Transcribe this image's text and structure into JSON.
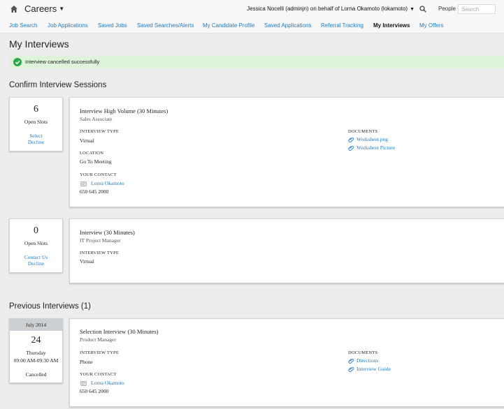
{
  "header": {
    "app_title": "Careers",
    "user_text": "Jessica Nocelli (adminjn) on behalf of Lorna Okamoto (lokamoto)",
    "people_label": "People",
    "search_placeholder": "Search"
  },
  "nav": {
    "tabs": [
      {
        "label": "Job Search",
        "active": false
      },
      {
        "label": "Job Applications",
        "active": false
      },
      {
        "label": "Saved Jobs",
        "active": false
      },
      {
        "label": "Saved Searches/Alerts",
        "active": false
      },
      {
        "label": "My Candidate Profile",
        "active": false
      },
      {
        "label": "Saved Applications",
        "active": false
      },
      {
        "label": "Referral Tracking",
        "active": false
      },
      {
        "label": "My Interviews",
        "active": true
      },
      {
        "label": "My Offers",
        "active": false
      }
    ]
  },
  "page": {
    "title": "My Interviews",
    "alert": "Interview cancelled successfully"
  },
  "confirm_section": {
    "title": "Confirm Interview Sessions",
    "sessions": [
      {
        "slots": "6",
        "slots_label": "Open Slots",
        "action1": "Select",
        "action2": "Decline",
        "title": "Interview High Volume (30 Minutes)",
        "subtitle": "Sales Associate",
        "type_label": "INTERVIEW TYPE",
        "type_value": "Virtual",
        "location_label": "LOCATION",
        "location_value": "Go To Meeting",
        "contact_label": "YOUR CONTACT",
        "contact_name": "Lorna Okamoto",
        "contact_phone": "650 645 2000",
        "documents_label": "DOCUMENTS",
        "documents": [
          "Worksheet.png",
          "Worksheet Picture"
        ]
      },
      {
        "slots": "0",
        "slots_label": "Open Slots",
        "action1": "Contact Us",
        "action2": "Decline",
        "title": "Interview (30 Minutes)",
        "subtitle": "IT Project Manager",
        "type_label": "INTERVIEW TYPE",
        "type_value": "Virtual"
      }
    ]
  },
  "previous_section": {
    "title": "Previous Interviews (1)",
    "interviews": [
      {
        "month": "July 2014",
        "day": "24",
        "weekday": "Thursday",
        "time": "09:00 AM-09:30 AM",
        "status": "Cancelled",
        "title": "Selection Interview (30 Minutes)",
        "subtitle": "Product Manager",
        "type_label": "INTERVIEW TYPE",
        "type_value": "Phone",
        "contact_label": "YOUR CONTACT",
        "contact_name": "Lorna Okamoto",
        "contact_phone": "650 645 2000",
        "documents_label": "DOCUMENTS",
        "documents": [
          "Directions",
          "Interview Guide"
        ]
      }
    ]
  },
  "colors": {
    "link": "#1f7ac4",
    "success_bg": "#dff2da",
    "success_icon": "#2aa84a"
  },
  "icons": [
    "home-icon",
    "search-icon",
    "checkmark-icon",
    "paperclip-icon",
    "contact-card-icon"
  ]
}
